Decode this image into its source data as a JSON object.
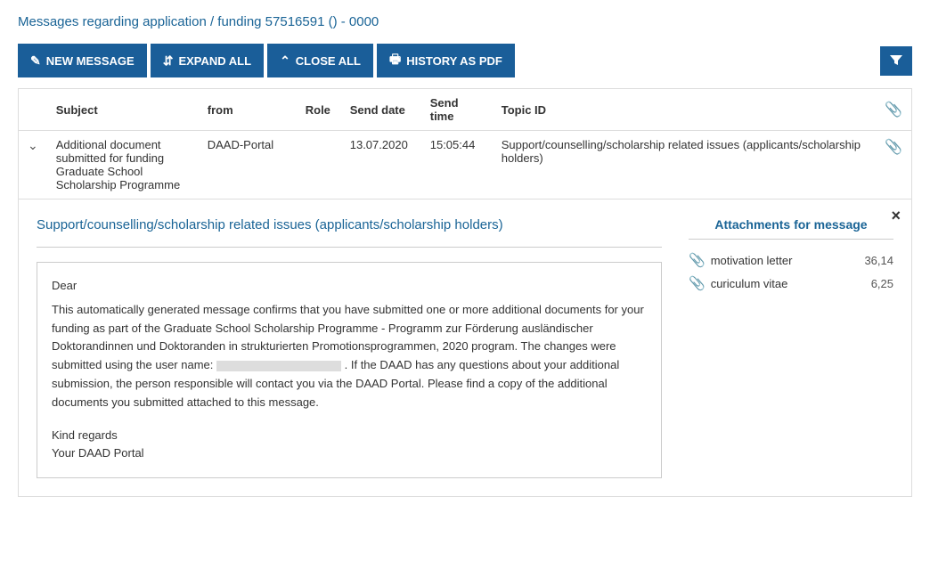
{
  "page": {
    "title": "Messages regarding application / funding 57516591 () - 0000"
  },
  "toolbar": {
    "new_message_label": "NEW MESSAGE",
    "expand_all_label": "EXPAND ALL",
    "close_all_label": "CLOSE ALL",
    "history_as_pdf_label": "HISTORY AS PDF"
  },
  "table": {
    "headers": {
      "subject": "Subject",
      "from": "from",
      "role": "Role",
      "send_date": "Send date",
      "send_time": "Send time",
      "topic_id": "Topic ID"
    },
    "rows": [
      {
        "expanded": true,
        "subject": "Additional document submitted for funding Graduate School Scholarship Programme",
        "from": "DAAD-Portal",
        "role": "",
        "send_date": "13.07.2020",
        "send_time": "15:05:44",
        "topic_id": "Support/counselling/scholarship related issues (applicants/scholarship holders)",
        "has_attachment": true
      }
    ]
  },
  "detail": {
    "topic_title": "Support/counselling/scholarship related issues (applicants/scholarship holders)",
    "message": {
      "greeting": "Dear",
      "body_part1": "This automatically generated message confirms that you have submitted one or more additional documents for your funding as part of the Graduate School Scholarship Programme - Programm zur Förderung ausländischer Doktorandinnen und Doktoranden in strukturierten Promotionsprogrammen, 2020 program. The changes were submitted using the user name:",
      "body_part2": ". If the DAAD has any questions about your additional submission, the person responsible will contact you via the DAAD Portal. Please find a copy of the additional documents you submitted attached to this message.",
      "closing": "Kind regards",
      "signature": "Your DAAD Portal"
    },
    "attachments": {
      "title": "Attachments for message",
      "items": [
        {
          "name": "motivation letter",
          "size": "36,14"
        },
        {
          "name": "curiculum vitae",
          "size": "6,25"
        }
      ]
    }
  },
  "icons": {
    "new_message": "🖊",
    "expand_all": "⇵",
    "close_all": "⇵",
    "history_pdf": "🖨",
    "filter": "▽",
    "attachment": "🔗",
    "chevron_down": "∨",
    "close": "×"
  }
}
